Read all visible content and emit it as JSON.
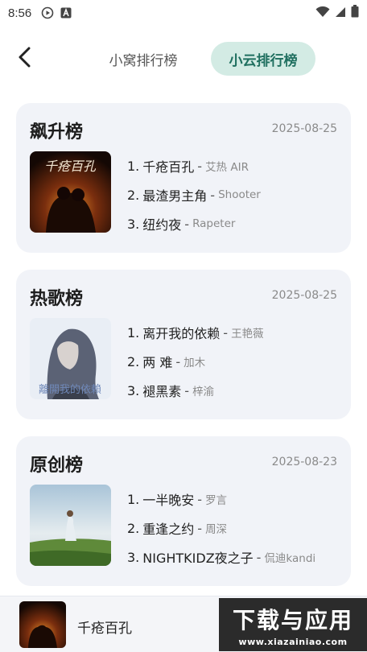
{
  "status_bar": {
    "time": "8:56"
  },
  "nav": {
    "tabs": [
      {
        "label": "小窝排行榜",
        "active": false
      },
      {
        "label": "小云排行榜",
        "active": true
      }
    ]
  },
  "charts": [
    {
      "title": "飙升榜",
      "date": "2025-08-25",
      "cover_text": "千疮百孔",
      "tracks": [
        {
          "num": "1.",
          "song": "千疮百孔",
          "artist": "艾热 AIR"
        },
        {
          "num": "2.",
          "song": "最渣男主角",
          "artist": "Shooter"
        },
        {
          "num": "3.",
          "song": "纽约夜",
          "artist": "Rapeter"
        }
      ]
    },
    {
      "title": "热歌榜",
      "date": "2025-08-25",
      "cover_text": "離開我的依賴",
      "tracks": [
        {
          "num": "1.",
          "song": "离开我的依赖",
          "artist": "王艳薇"
        },
        {
          "num": "2.",
          "song": "两 难",
          "artist": "加木"
        },
        {
          "num": "3.",
          "song": "褪黑素",
          "artist": "梓渝"
        }
      ]
    },
    {
      "title": "原创榜",
      "date": "2025-08-23",
      "tracks": [
        {
          "num": "1.",
          "song": "一半晚安",
          "artist": "罗言"
        },
        {
          "num": "2.",
          "song": "重逢之约",
          "artist": "周深"
        },
        {
          "num": "3.",
          "song": "NIGHTKIDZ夜之子",
          "artist": "侃迪kandi"
        }
      ]
    }
  ],
  "player": {
    "title": "千疮百孔"
  },
  "watermark": {
    "main": "下载与应用",
    "sub": "www.xiazainiao.com"
  },
  "colors": {
    "accent_tab_bg": "#d3ebe4",
    "accent_tab_text": "#1f6f5f",
    "card_bg": "#f1f3f8"
  }
}
